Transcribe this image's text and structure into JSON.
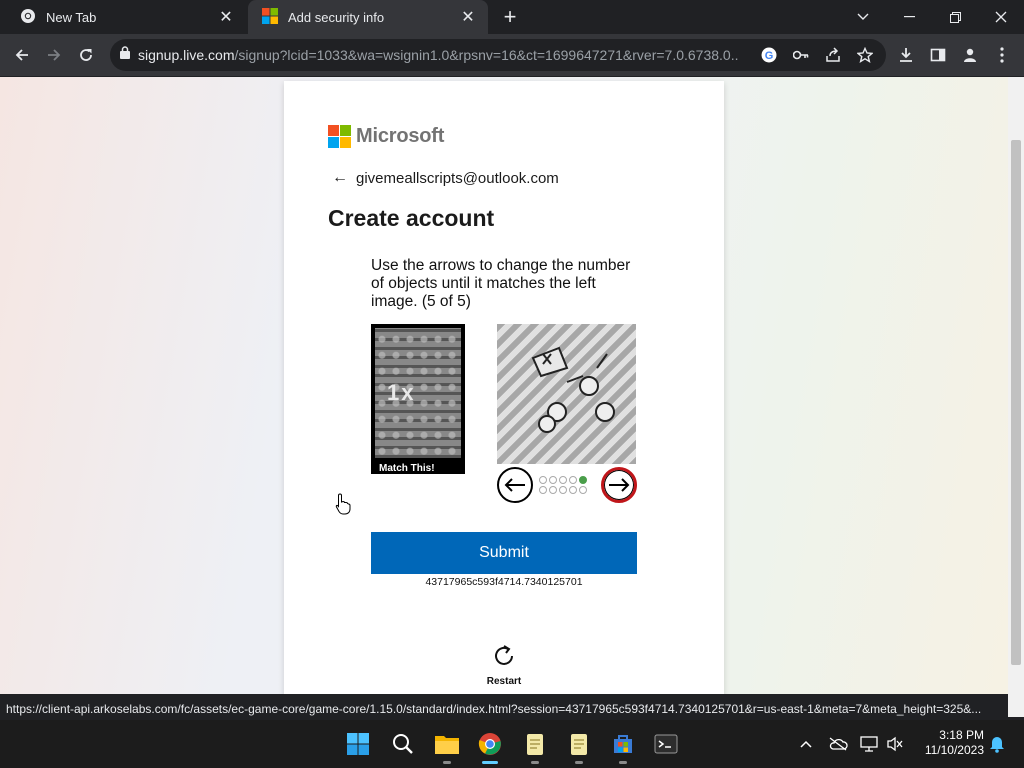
{
  "browser": {
    "tabs": [
      {
        "title": "New Tab",
        "icon": "chrome-icon",
        "active": false
      },
      {
        "title": "Add security info",
        "icon": "microsoft-icon",
        "active": true
      }
    ],
    "url_host": "signup.live.com",
    "url_rest": "/signup?lcid=1033&wa=wsignin1.0&rpsnv=16&ct=1699647271&rver=7.0.6738.0...",
    "status_url": "https://client-api.arkoselabs.com/fc/assets/ec-game-core/game-core/1.15.0/standard/index.html?session=43717965c593f4714.7340125701&r=us-east-1&meta=7&meta_height=325&..."
  },
  "page": {
    "brand": "Microsoft",
    "identity_email": "givemeallscripts@outlook.com",
    "heading": "Create account",
    "puzzle": {
      "instruction": "Use the arrows to change the number of objects until it matches the left image. (5 of 5)",
      "target_caption": "Match This!",
      "target_glyph": "1x",
      "progress_total": 10,
      "progress_current": 5
    },
    "submit_label": "Submit",
    "session_id": "43717965c593f4714.7340125701",
    "restart_label": "Restart"
  },
  "taskbar": {
    "apps": [
      "start-icon",
      "search-icon",
      "file-explorer-icon",
      "chrome-icon",
      "notepad-icon",
      "notepad-icon",
      "store-icon",
      "terminal-icon"
    ],
    "time": "3:18 PM",
    "date": "11/10/2023"
  },
  "colors": {
    "accent": "#0067b8",
    "ms_red": "#f25022",
    "ms_green": "#7fba00",
    "ms_blue": "#00a4ef",
    "ms_yellow": "#ffb900"
  }
}
